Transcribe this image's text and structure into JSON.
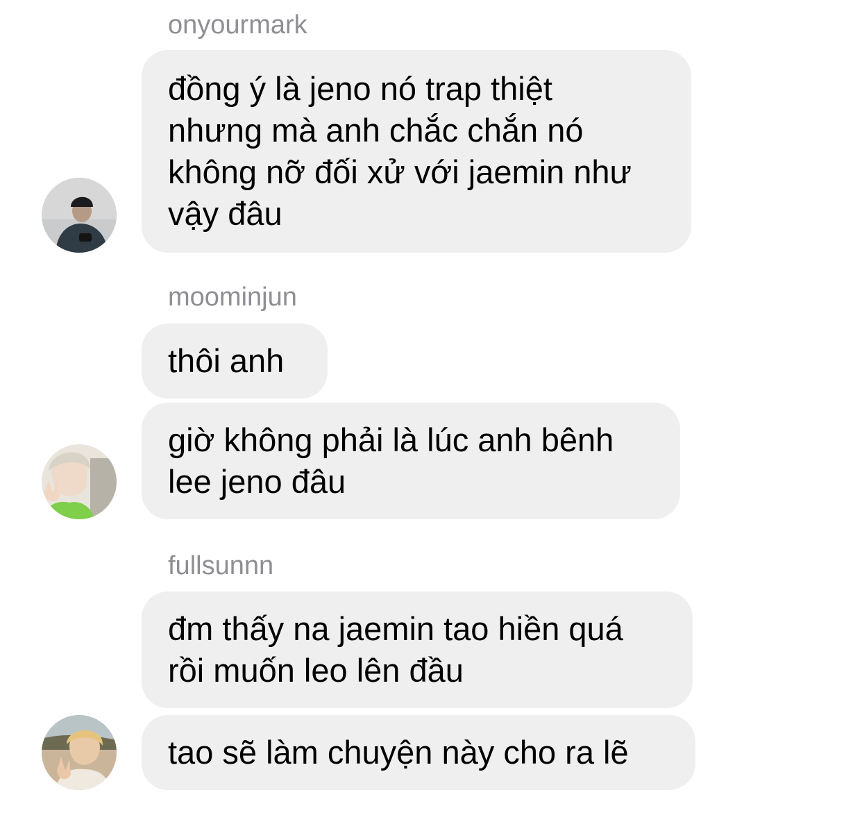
{
  "groups": [
    {
      "sender": "onyourmark",
      "avatar_icon": "user-photo-beanie-icon",
      "messages": [
        {
          "lines": [
            "đồng ý là jeno nó trap thiệt",
            "nhưng mà anh chắc chắn nó",
            "không nỡ đối xử với jaemin như",
            "vậy đâu"
          ]
        }
      ]
    },
    {
      "sender": "moominjun",
      "avatar_icon": "user-photo-peace-sign-icon",
      "messages": [
        {
          "lines": [
            "thôi anh"
          ]
        },
        {
          "lines": [
            "giờ không phải là lúc anh bênh",
            "lee jeno đâu"
          ]
        }
      ]
    },
    {
      "sender": "fullsunnn",
      "avatar_icon": "user-photo-outdoor-icon",
      "messages": [
        {
          "lines": [
            "đm thấy na jaemin tao hiền quá",
            "rồi muốn leo lên đầu"
          ]
        },
        {
          "lines": [
            "tao sẽ làm chuyện này cho ra lẽ"
          ]
        }
      ]
    }
  ],
  "colors": {
    "bubble_bg": "#efefef",
    "sender_text": "#8e8e93",
    "message_text": "#000000"
  }
}
